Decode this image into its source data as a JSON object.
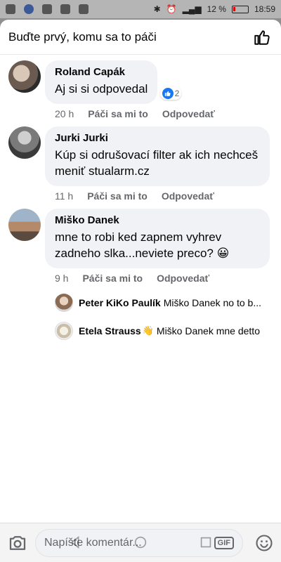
{
  "status": {
    "battery_percent": "12 %",
    "time": "18:59",
    "icons": [
      "facebook-icon",
      "image-icon",
      "download-icon",
      "bluetooth-icon",
      "alarm-icon",
      "signal-icon"
    ]
  },
  "header": {
    "title": "Buďte prvý, komu sa to páči",
    "like_icon": "thumbs-up-icon"
  },
  "comments": [
    {
      "author": "Roland Capák",
      "text": "Aj si si odpovedal",
      "time": "20 h",
      "like_label": "Páči sa mi to",
      "reply_label": "Odpovedať",
      "reaction_count": "2"
    },
    {
      "author": "Jurki Jurki",
      "text": "Kúp si odrušovací filter ak ich nechceš meniť stualarm.cz",
      "time": "11 h",
      "like_label": "Páči sa mi to",
      "reply_label": "Odpovedať"
    },
    {
      "author": "Miško Danek",
      "text": "mne to robi ked zapnem vyhrev zadneho slka...neviete preco? 😀",
      "time": "9 h",
      "like_label": "Páči sa mi to",
      "reply_label": "Odpovedať",
      "replies": [
        {
          "author": "Peter KiKo Paulík",
          "text": "Miško Danek no to b..."
        },
        {
          "author": "Etela Strauss",
          "text": "Miško Danek mne detto",
          "emoji": "👋"
        }
      ]
    }
  ],
  "composer": {
    "placeholder": "Napíšte komentár...",
    "gif_label": "GIF"
  },
  "colors": {
    "accent": "#1877f2",
    "bubble": "#f0f2f5",
    "meta_text": "#65676b"
  }
}
